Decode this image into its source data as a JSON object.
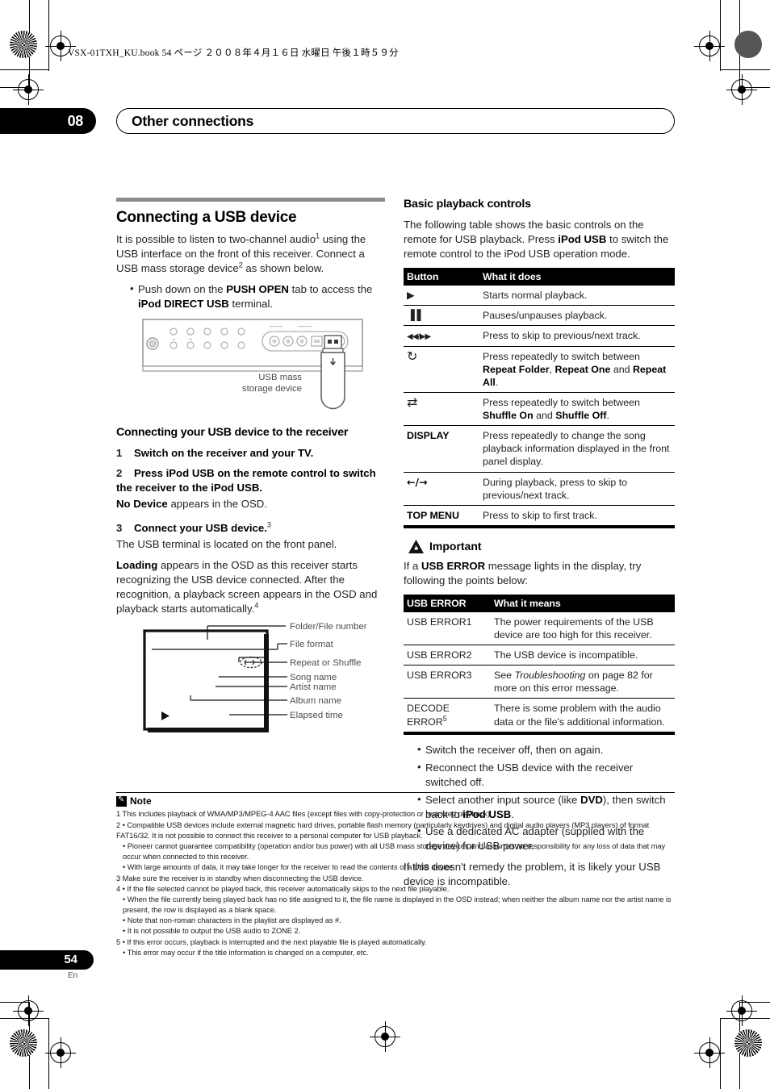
{
  "printer": {
    "file_stamp": "VSX-01TXH_KU.book   54 ページ   ２００８年４月１６日   水曜日   午後１時５９分"
  },
  "header": {
    "chapter_number": "08",
    "chapter_title": "Other connections"
  },
  "left_column": {
    "section_title": "Connecting a USB device",
    "intro": "It is possible to listen to two-channel audio",
    "intro_sup1": "1",
    "intro_cont": " using the USB interface on the front of this receiver. Connect a USB mass storage device",
    "intro_sup2": "2",
    "intro_end": " as shown below.",
    "bullet_1_pre": "Push down on the ",
    "bullet_1_b1": "PUSH OPEN",
    "bullet_1_mid": " tab to access the ",
    "bullet_1_b2": "iPod DIRECT USB",
    "bullet_1_end": " terminal.",
    "figure_receiver_caption_line1": "USB mass",
    "figure_receiver_caption_line2": "storage device",
    "subsection_title": "Connecting your USB device to the receiver",
    "steps": [
      {
        "num": "1",
        "bold": "Switch on the receiver and your TV.",
        "plain": ""
      },
      {
        "num": "2",
        "bold": "Press iPod USB on the remote control to switch the receiver to the iPod USB.",
        "plain": ""
      },
      {
        "num": "3",
        "bold": "Connect your USB device.",
        "sup": "3",
        "plain": ""
      }
    ],
    "step2_note_bold": "No Device",
    "step2_note_plain": " appears in the OSD.",
    "step3_note": "The USB terminal is located on the front panel.",
    "loading_bold": "Loading",
    "loading_plain": " appears in the OSD as this receiver starts recognizing the USB device connected. After the recognition, a playback screen appears in the OSD and playback starts automatically.",
    "loading_sup": "4",
    "osd_labels": [
      "Folder/File number",
      "File format",
      "Repeat or Shuffle",
      "Song name",
      "Artist name",
      "Album name",
      "Elapsed time"
    ]
  },
  "right_column": {
    "section_title": "Basic playback controls",
    "intro_a": "The following table shows the basic controls on the remote for USB playback. Press ",
    "intro_b": "iPod USB",
    "intro_c": " to switch the remote control to the iPod USB operation mode.",
    "controls_table": {
      "headers": [
        "Button",
        "What it does"
      ],
      "rows": [
        {
          "button_icon": "play-icon",
          "button": "▶",
          "bold": false,
          "text": "Starts normal playback."
        },
        {
          "button_icon": "pause-icon",
          "button": "▐▐",
          "bold": false,
          "text": "Pauses/unpauses playback."
        },
        {
          "button_icon": "skip-prev-next-icon",
          "button": "◀◀/▶▶",
          "bold": false,
          "text": "Press to skip to previous/next track."
        },
        {
          "button_icon": "repeat-icon",
          "button": "↻",
          "bold": false,
          "text": "Press repeatedly to switch between Repeat Folder, Repeat One and Repeat All.",
          "rich": [
            {
              "t": "Press repeatedly to switch between ",
              "b": false
            },
            {
              "t": "Repeat Folder",
              "b": true
            },
            {
              "t": ", ",
              "b": false
            },
            {
              "t": "Repeat One",
              "b": true
            },
            {
              "t": " and ",
              "b": false
            },
            {
              "t": "Repeat All",
              "b": true
            },
            {
              "t": ".",
              "b": false
            }
          ]
        },
        {
          "button_icon": "shuffle-icon",
          "button": "⇄",
          "bold": false,
          "text": "Press repeatedly to switch between Shuffle On and Shuffle Off.",
          "rich": [
            {
              "t": "Press repeatedly to switch between ",
              "b": false
            },
            {
              "t": "Shuffle On",
              "b": true
            },
            {
              "t": " and ",
              "b": false
            },
            {
              "t": "Shuffle Off",
              "b": true
            },
            {
              "t": ".",
              "b": false
            }
          ]
        },
        {
          "button_icon": "display-button",
          "button": "DISPLAY",
          "bold": true,
          "text": "Press repeatedly to change the song playback information displayed in the front panel display."
        },
        {
          "button_icon": "left-right-arrows-icon",
          "button": "←/→",
          "bold": true,
          "text": "During playback, press to skip to previous/next track."
        },
        {
          "button_icon": "top-menu-button",
          "button": "TOP MENU",
          "bold": true,
          "text": "Press to skip to first track."
        }
      ]
    },
    "important_label": "Important",
    "important_intro_a": "If a ",
    "important_intro_b": "USB ERROR",
    "important_intro_c": " message lights in the display, try following the points below:",
    "error_table": {
      "headers": [
        "USB ERROR",
        "What it means"
      ],
      "rows": [
        {
          "code": "USB ERROR1",
          "meaning": "The power requirements of the USB device are too high for this receiver."
        },
        {
          "code": "USB ERROR2",
          "meaning": "The USB device is incompatible."
        },
        {
          "code": "USB ERROR3",
          "meaning": "See Troubleshooting on page 82 for more on this error message.",
          "rich": [
            {
              "t": "See ",
              "i": false
            },
            {
              "t": "Troubleshooting",
              "i": true
            },
            {
              "t": " on page 82 for more on this error message.",
              "i": false
            }
          ]
        },
        {
          "code": "DECODE ERROR",
          "code_sup": "5",
          "meaning": "There is some problem with the audio data or the file's additional information."
        }
      ]
    },
    "remedy_bullets": [
      {
        "rich": [
          {
            "t": "Switch the receiver off, then on again.",
            "b": false
          }
        ]
      },
      {
        "rich": [
          {
            "t": "Reconnect the USB device with the receiver switched off.",
            "b": false
          }
        ]
      },
      {
        "rich": [
          {
            "t": "Select another input source (like ",
            "b": false
          },
          {
            "t": "DVD",
            "b": true
          },
          {
            "t": "), then switch back to ",
            "b": false
          },
          {
            "t": "iPod USB",
            "b": true
          },
          {
            "t": ".",
            "b": false
          }
        ]
      },
      {
        "rich": [
          {
            "t": "Use a dedicated AC adapter (supplied with the device) for USB power.",
            "b": false
          }
        ]
      }
    ],
    "closing": "If this doesn't remedy the problem, it is likely your USB device is incompatible."
  },
  "notes": {
    "label": "Note",
    "lines": [
      {
        "text": "1 This includes playback of WMA/MP3/MPEG-4 AAC files (except files with copy-protection or restricted playback).",
        "style": "plain"
      },
      {
        "text": "2 • Compatible USB devices include external magnetic hard drives, portable flash memory (particularly keydrives) and digital audio players (MP3 players) of format FAT16/32. It is not possible to connect this receiver to a personal computer for USB playback.",
        "style": "plain"
      },
      {
        "text": "• Pioneer cannot guarantee compatibility (operation and/or bus power) with all USB mass storage devices and assumes no responsibility for any loss of data that may occur when connected to this receiver.",
        "style": "indent"
      },
      {
        "text": "• With large amounts of data, it may take longer for the receiver to read the contents of a USB device.",
        "style": "indent"
      },
      {
        "text": "3 Make sure the receiver is in standby when disconnecting the USB device.",
        "style": "plain"
      },
      {
        "text": "4 • If the file selected cannot be played back, this receiver automatically skips to the next file playable.",
        "style": "plain"
      },
      {
        "text": "• When the file currently being played back has no title assigned to it, the file name is displayed in the OSD instead; when neither the album name nor the artist name is present, the row is displayed as a blank space.",
        "style": "indent"
      },
      {
        "text": "• Note that non-roman characters in the playlist are displayed as #.",
        "style": "indent"
      },
      {
        "text": "• It is not possible to output the USB audio to ZONE 2.",
        "style": "indent"
      },
      {
        "text": "5 • If this error occurs, playback is interrupted and the next playable file is played automatically.",
        "style": "plain"
      },
      {
        "text": "• This error may occur if the title information is changed on a computer, etc.",
        "style": "indent"
      }
    ]
  },
  "footer": {
    "page_number": "54",
    "language_code": "En"
  }
}
